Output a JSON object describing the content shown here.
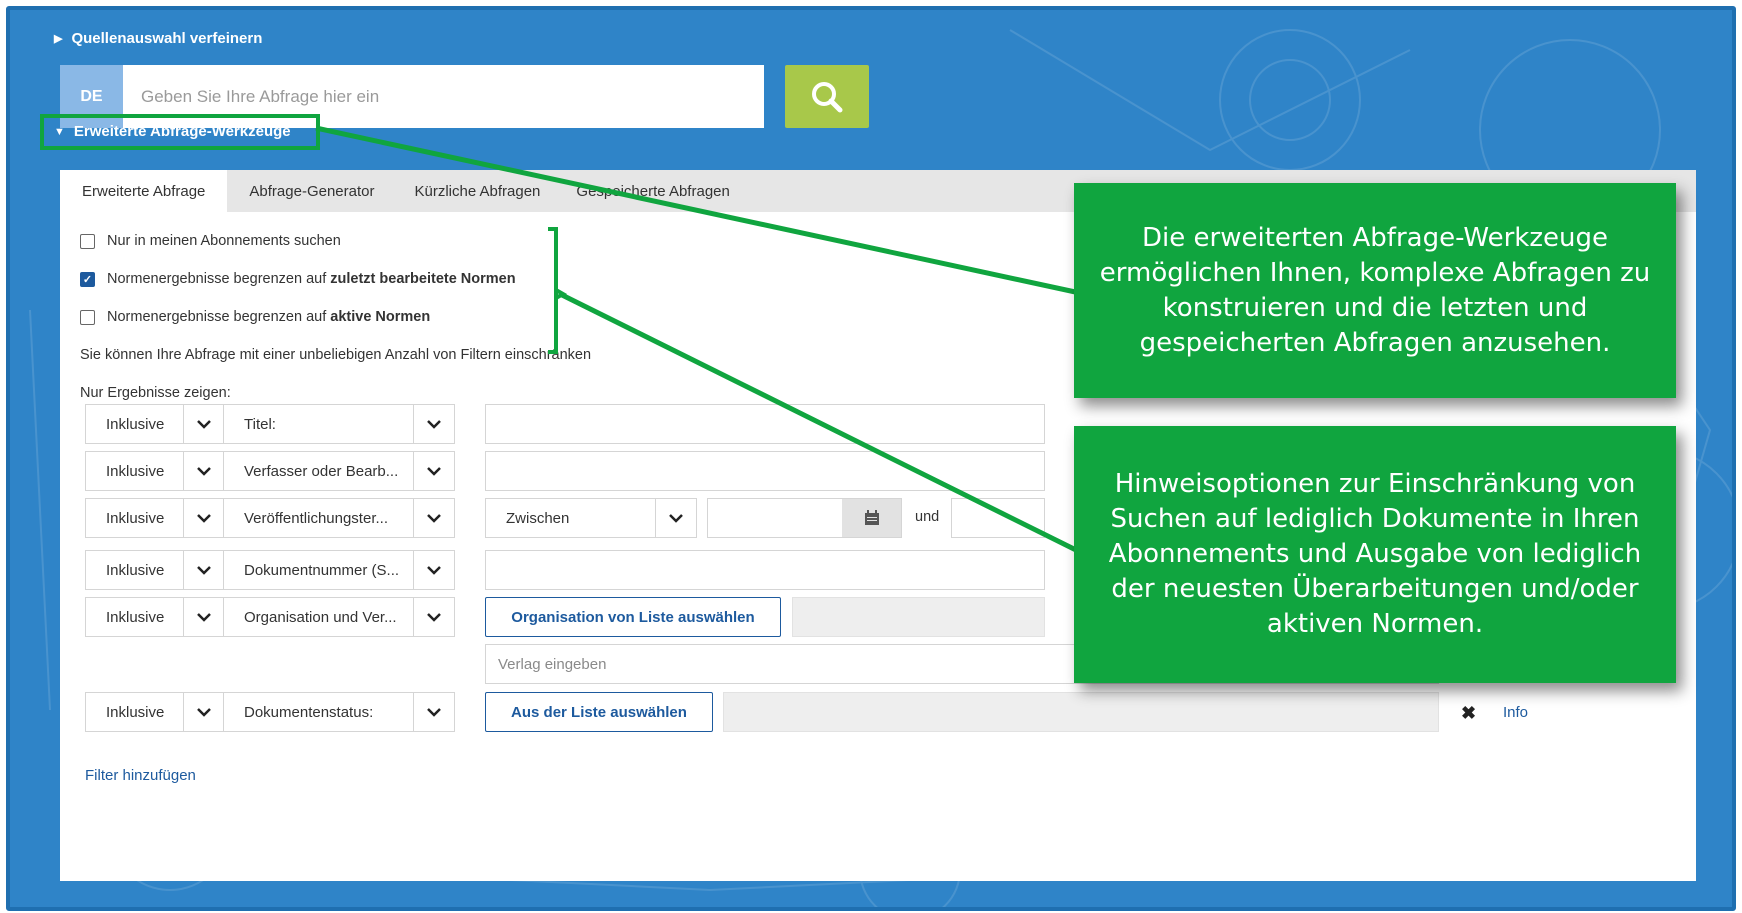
{
  "refine_source_label": "Quellenauswahl verfeinern",
  "search": {
    "lang": "DE",
    "placeholder": "Geben Sie Ihre Abfrage hier ein"
  },
  "advanced_tools_label": "Erweiterte Abfrage-Werkzeuge",
  "tabs": [
    {
      "label": "Erweiterte Abfrage",
      "active": true
    },
    {
      "label": "Abfrage-Generator",
      "active": false
    },
    {
      "label": "Kürzliche Abfragen",
      "active": false
    },
    {
      "label": "Gespeicherte Abfragen",
      "active": false
    }
  ],
  "checkboxes": [
    {
      "text": "Nur in meinen Abonnements suchen",
      "bold": "",
      "checked": false
    },
    {
      "text": "Normenergebnisse begrenzen auf ",
      "bold": "zuletzt bearbeitete Normen",
      "checked": true
    },
    {
      "text": "Normenergebnisse begrenzen auf ",
      "bold": "aktive Normen",
      "checked": false
    }
  ],
  "filter_hint": "Sie können Ihre Abfrage mit einer unbeliebigen Anzahl von Filtern einschränken",
  "only_show_label": "Nur Ergebnisse zeigen:",
  "filters": {
    "inclusive": "Inklusive",
    "rows": [
      {
        "field": "Titel:"
      },
      {
        "field": "Verfasser oder Bearb..."
      },
      {
        "field": "Veröffentlichungster...",
        "range": "Zwischen",
        "and": "und"
      },
      {
        "field": "Dokumentnummer (S..."
      },
      {
        "field": "Organisation und Ver...",
        "button": "Organisation von Liste auswählen",
        "publisher_placeholder": "Verlag eingeben"
      },
      {
        "field": "Dokumentenstatus:",
        "button": "Aus der Liste auswählen",
        "info": "Info"
      }
    ]
  },
  "add_filter_label": "Filter hinzufügen",
  "callouts": {
    "tools": "Die erweiterten Abfrage-Werkzeuge ermöglichen Ihnen, komplexe Abfragen zu konstruieren und die letzten und gespeicherten Abfragen anzusehen.",
    "options": "Hinweisoptionen zur Einschränkung von Suchen auf lediglich Dokumente in Ihren Abonnements und Ausgabe von lediglich der neuesten Überarbeitungen und/oder aktiven Normen."
  },
  "colors": {
    "background": "#2f84c8",
    "callout": "#10a53f",
    "search_button": "#a8c84a",
    "link": "#1d5a9e",
    "lang_badge": "#8ab8e6"
  },
  "icons": [
    "search-icon",
    "calendar-icon",
    "close-icon",
    "chevron-down-icon",
    "caret-right-icon",
    "caret-down-icon"
  ]
}
